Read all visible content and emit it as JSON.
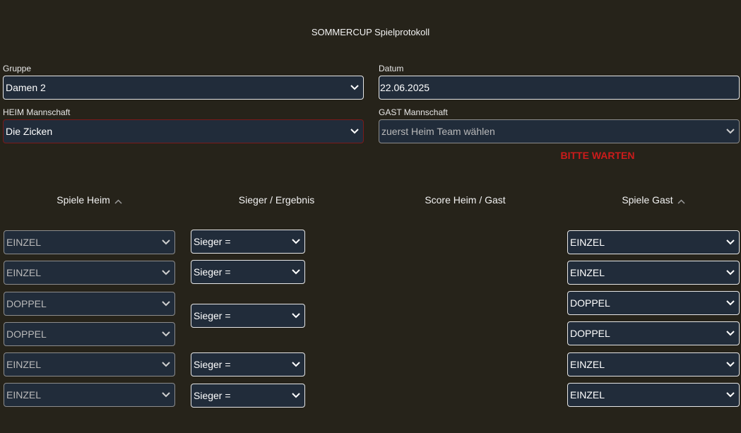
{
  "title": "SOMMERCUP Spielprotokoll",
  "gruppe": {
    "label": "Gruppe",
    "value": "Damen 2"
  },
  "datum": {
    "label": "Datum",
    "value": "22.06.2025"
  },
  "heim": {
    "label": "HEIM Mannschaft",
    "value": "Die Zicken"
  },
  "gast": {
    "label": "GAST Mannschaft",
    "placeholder": "zuerst Heim Team wählen"
  },
  "status": "BITTE WARTEN",
  "columns": {
    "spiele_heim": "Spiele Heim",
    "sieger_ergebnis": "Sieger / Ergebnis",
    "score": "Score Heim / Gast",
    "spiele_gast": "Spiele Gast"
  },
  "heim_spiele": [
    "EINZEL",
    "EINZEL",
    "DOPPEL",
    "DOPPEL",
    "EINZEL",
    "EINZEL"
  ],
  "gast_spiele": [
    "EINZEL",
    "EINZEL",
    "DOPPEL",
    "DOPPEL",
    "EINZEL",
    "EINZEL"
  ],
  "sieger": [
    "Sieger =",
    "Sieger =",
    "Sieger =",
    "Sieger =",
    "Sieger ="
  ],
  "colors": {
    "background": "#26231a",
    "field": "#212c3a",
    "warn": "#cc1b1b"
  }
}
